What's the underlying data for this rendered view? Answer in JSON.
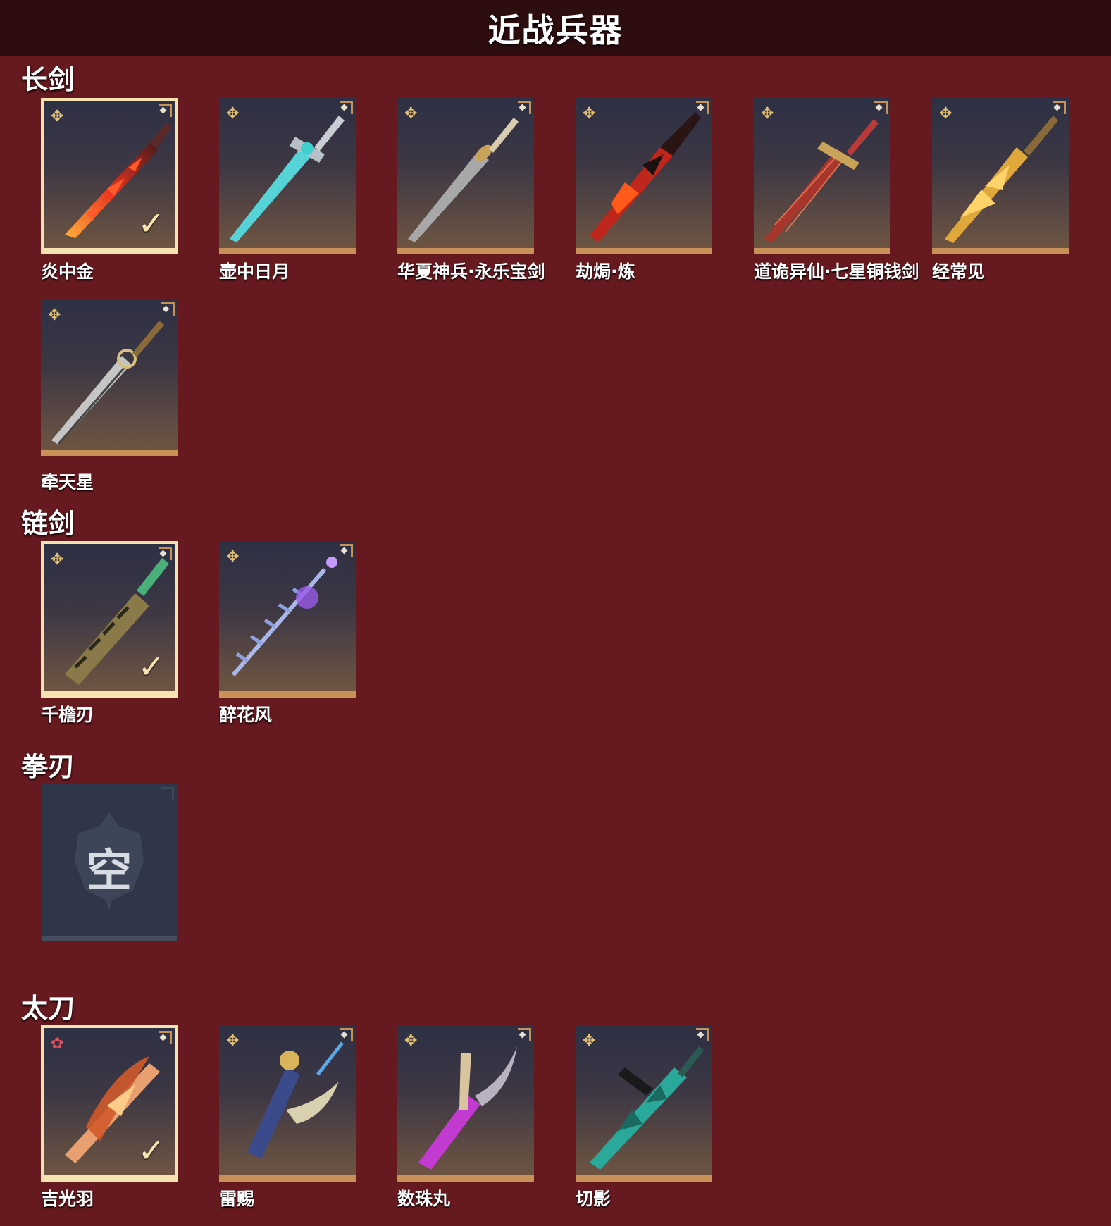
{
  "page": {
    "title": "近战兵器"
  },
  "sections": {
    "longsword": {
      "title": "长剑",
      "items": [
        {
          "name": "炎中金"
        },
        {
          "name": "壶中日月"
        },
        {
          "name": "华夏神兵·永乐宝剑"
        },
        {
          "name": "劫焗·炼"
        },
        {
          "name": "道诡异仙·七星铜钱剑"
        },
        {
          "name": "经常见"
        },
        {
          "name": "牵天星"
        }
      ]
    },
    "chainsword": {
      "title": "链剑",
      "items": [
        {
          "name": "千檐刃"
        },
        {
          "name": "醉花风"
        }
      ]
    },
    "fistblade": {
      "title": "拳刃",
      "empty_label": "空"
    },
    "katana": {
      "title": "太刀",
      "items": [
        {
          "name": "吉光羽"
        },
        {
          "name": "雷赐"
        },
        {
          "name": "数珠丸"
        },
        {
          "name": "切影"
        }
      ]
    }
  },
  "icons": {
    "rarity_gold": "gold-shuriken-icon",
    "rarity_red": "red-flower-icon",
    "equipped": "check-icon",
    "corner": "corner-badge-icon"
  },
  "colors": {
    "background": "#661a20",
    "topbar": "#2e0d0f",
    "card_trim": "#c79158",
    "selected_border": "#f6e3b1"
  }
}
